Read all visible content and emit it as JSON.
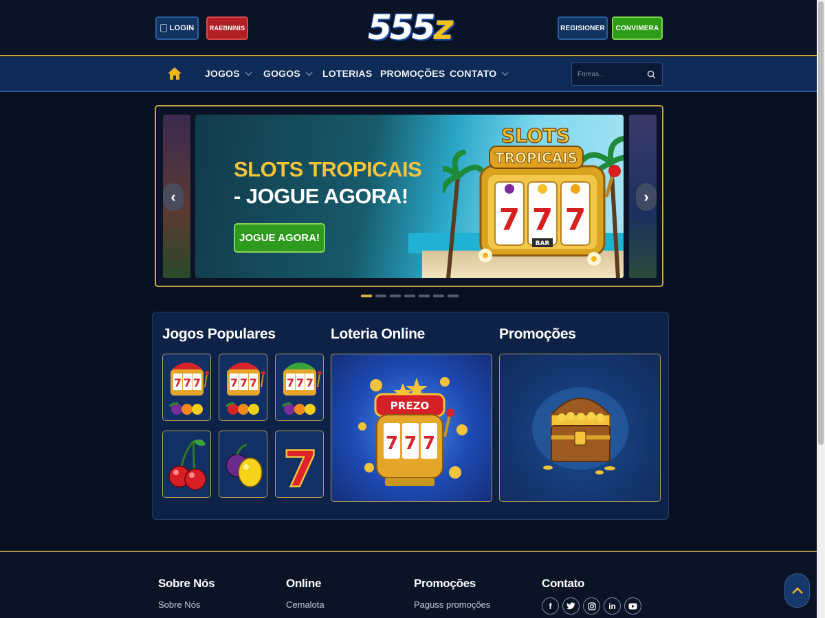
{
  "header": {
    "login_label": "LOGIN",
    "red_button_label": "RAEBNINIS",
    "logo_white": "555",
    "logo_yellow": "z",
    "register_label": "REGISIONER",
    "green_button_label": "CONVIMERA"
  },
  "nav": {
    "items": [
      {
        "label": "JOGOS"
      },
      {
        "label": "GOGOS"
      },
      {
        "label": "LOTERIAS"
      },
      {
        "label": "PROMOÇÕES"
      },
      {
        "label": "CONTATO"
      }
    ],
    "search_placeholder": "Fnreas..."
  },
  "carousel": {
    "title_line1": "SLOTS TROPICAIS",
    "title_line2": "- JOGUE AGORA!",
    "cta_label": "JOGUE AGORA!",
    "art_title_1": "SLOTS",
    "art_title_2": "TROPICAIS",
    "reel_symbol": "7",
    "bar_label": "BAR",
    "active_slide": 1,
    "slide_count": 7
  },
  "sections": {
    "popular_title": "Jogos Populares",
    "lottery_title": "Loteria Online",
    "promos_title": "Promoções",
    "lottery_badge": "PREZO"
  },
  "footer": {
    "columns": [
      {
        "title": "Sobre Nós",
        "link": "Sobre Nós"
      },
      {
        "title": "Online",
        "link": "Cemalota"
      },
      {
        "title": "Promoções",
        "link": "Paguss promoções"
      },
      {
        "title": "Contato"
      }
    ],
    "social_icons": [
      "facebook-icon",
      "twitter-icon",
      "instagram-icon",
      "linkedin-icon",
      "youtube-icon"
    ]
  },
  "colors": {
    "gold_border": "#c9a445",
    "nav_bg": "#0e2a57",
    "green_button": "#2f9c18",
    "red_button": "#b21f25",
    "title_yellow": "#f6c43a"
  }
}
